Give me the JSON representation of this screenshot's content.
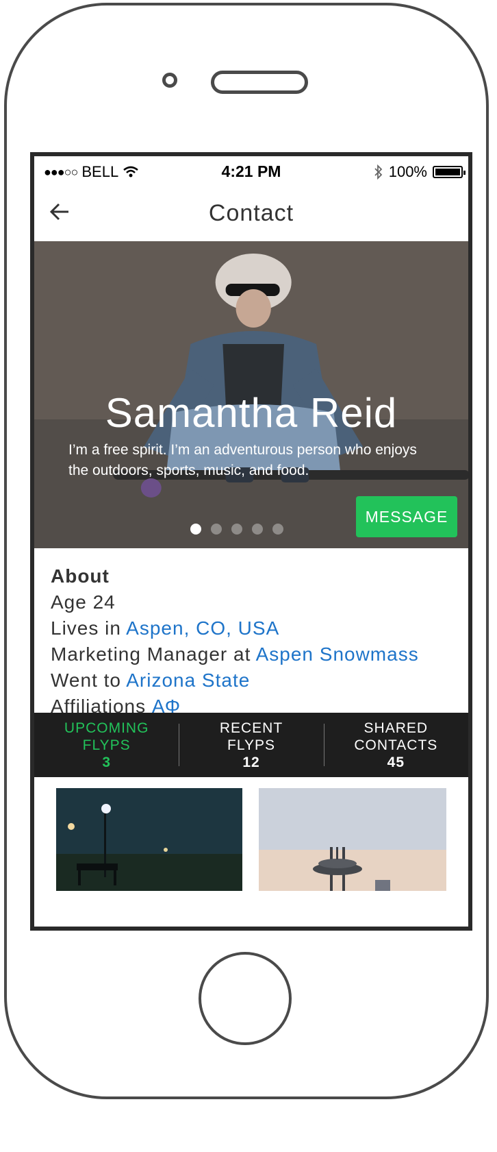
{
  "status_bar": {
    "signal": "●●●○○",
    "carrier": "BELL",
    "time": "4:21 PM",
    "battery": "100%"
  },
  "header": {
    "title": "Contact"
  },
  "profile": {
    "name": "Samantha Reid",
    "bio": "I’m a free spirit. I’m an adventurous person who enjoys the outdoors, sports, music, and food.",
    "message_label": "MESSAGE",
    "photo_count": 5,
    "active_photo_index": 0
  },
  "about": {
    "heading": "About",
    "age": "Age 24",
    "lives_prefix": "Lives in",
    "lives_link": "Aspen, CO, USA",
    "job_prefix": "Marketing Manager at",
    "job_link": "Aspen Snowmass",
    "school_prefix": "Went to",
    "school_link": "Arizona State",
    "affiliations_prefix": "Affiliations",
    "affiliations_link": "ΑΦ"
  },
  "stats": [
    {
      "line1": "UPCOMING",
      "line2": "FLYPS",
      "value": "3"
    },
    {
      "line1": "RECENT",
      "line2": "FLYPS",
      "value": "12"
    },
    {
      "line1": "SHARED",
      "line2": "CONTACTS",
      "value": "45"
    }
  ],
  "colors": {
    "accent_green": "#22c25a",
    "link_blue": "#1e74c9",
    "stats_bar": "#1e1e1e",
    "phone_outline": "#4a4a4a"
  },
  "icons": {
    "back": "arrow-left-icon",
    "wifi": "wifi-icon",
    "bluetooth": "bluetooth-icon",
    "battery": "battery-icon"
  }
}
